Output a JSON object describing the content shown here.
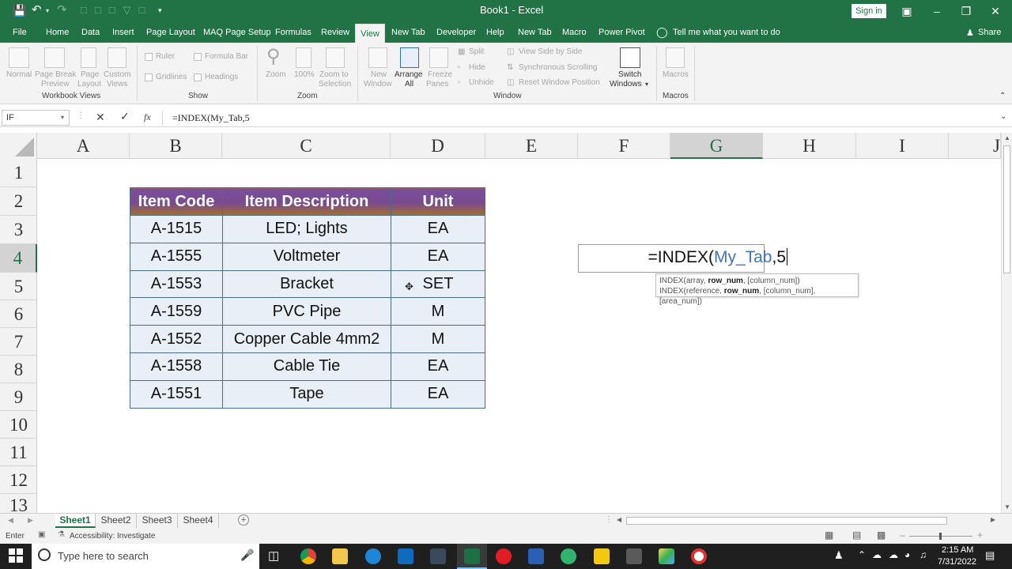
{
  "title_bar": {
    "doc_title": "Book1  -  Excel",
    "signin_label": "Sign in"
  },
  "menu": {
    "items": [
      "File",
      "Home",
      "Data",
      "Insert",
      "Page Layout",
      "MAQ Page Setup",
      "Formulas",
      "Review",
      "View",
      "New Tab",
      "Developer",
      "Help",
      "New Tab",
      "Macro",
      "Power Pivot"
    ],
    "tell_me": "Tell me what you want to do",
    "share": "Share"
  },
  "ribbon": {
    "workbook_views": {
      "normal": "Normal",
      "page_break_1": "Page Break",
      "page_break_2": "Preview",
      "page_layout_1": "Page",
      "page_layout_2": "Layout",
      "custom_1": "Custom",
      "custom_2": "Views",
      "group": "Workbook Views"
    },
    "show": {
      "ruler": "Ruler",
      "formula_bar": "Formula Bar",
      "gridlines": "Gridlines",
      "headings": "Headings",
      "group": "Show"
    },
    "zoom": {
      "zoom": "Zoom",
      "hundred": "100%",
      "sel_1": "Zoom to",
      "sel_2": "Selection",
      "group": "Zoom"
    },
    "window": {
      "new_1": "New",
      "new_2": "Window",
      "arrange_1": "Arrange",
      "arrange_2": "All",
      "freeze_1": "Freeze",
      "freeze_2": "Panes",
      "split": "Split",
      "hide": "Hide",
      "unhide": "Unhide",
      "side": "View Side by Side",
      "sync": "Synchronous Scrolling",
      "reset": "Reset Window Position",
      "switch_1": "Switch",
      "switch_2": "Windows",
      "group": "Window"
    },
    "macros": {
      "label": "Macros",
      "group": "Macros"
    }
  },
  "formula_bar": {
    "name_box": "IF",
    "fx": "fx",
    "formula": "=INDEX(My_Tab,5"
  },
  "columns": [
    "A",
    "B",
    "C",
    "D",
    "E",
    "F",
    "G",
    "H",
    "I",
    "J"
  ],
  "rows": [
    "1",
    "2",
    "3",
    "4",
    "5",
    "6",
    "7",
    "8",
    "9",
    "10",
    "11",
    "12",
    "13"
  ],
  "table": {
    "headers": [
      "Item Code",
      "Item Description",
      "Unit"
    ],
    "rows": [
      [
        "A-1515",
        "LED; Lights",
        "EA"
      ],
      [
        "A-1555",
        "Voltmeter",
        "EA"
      ],
      [
        "A-1553",
        "Bracket",
        "SET"
      ],
      [
        "A-1559",
        "PVC Pipe",
        "M"
      ],
      [
        "A-1552",
        "Copper Cable 4mm2",
        "M"
      ],
      [
        "A-1558",
        "Cable Tie",
        "EA"
      ],
      [
        "A-1551",
        "Tape",
        "EA"
      ]
    ]
  },
  "edit_cell": {
    "prefix": "=INDEX(",
    "ref": "My_Tab",
    "suffix": ",5"
  },
  "tooltip": {
    "line1_a": "INDEX(array, ",
    "line1_b": "row_num",
    "line1_c": ", [column_num])",
    "line2_a": "INDEX(reference, ",
    "line2_b": "row_num",
    "line2_c": ", [column_num], [area_num])"
  },
  "sheets": [
    "Sheet1",
    "Sheet2",
    "Sheet3",
    "Sheet4"
  ],
  "status": {
    "mode": "Enter",
    "accessibility": "Accessibility: Investigate"
  },
  "taskbar": {
    "search_placeholder": "Type here to search",
    "time": "2:15 AM",
    "date": "7/31/2022"
  },
  "colors": {
    "excel_green": "#217346",
    "header_purple": "#7b4f9e",
    "header_gold": "#a4702a",
    "cell_fill": "#e9eff7"
  }
}
